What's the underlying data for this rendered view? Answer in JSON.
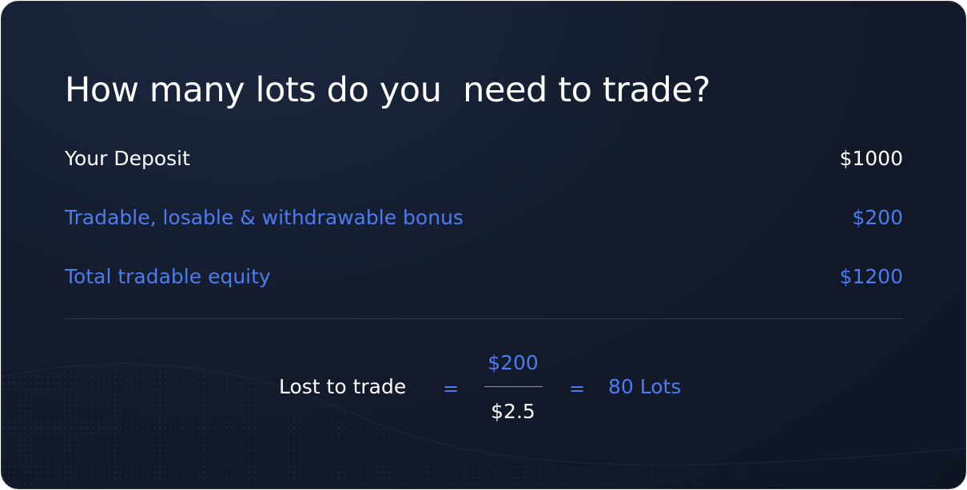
{
  "title": "How many lots do you  need to trade?",
  "rows": [
    {
      "label": "Your Deposit",
      "value": "$1000"
    },
    {
      "label": "Tradable, losable & withdrawable bonus",
      "value": "$200"
    },
    {
      "label": "Total tradable equity",
      "value": "$1200"
    }
  ],
  "formula": {
    "label": "Lost to trade",
    "equals": "=",
    "numerator": "$200",
    "denominator": "$2.5",
    "result": "80 Lots"
  },
  "colors": {
    "background": "#141c2d",
    "accent": "#4c7cf0",
    "text": "#ffffff"
  }
}
